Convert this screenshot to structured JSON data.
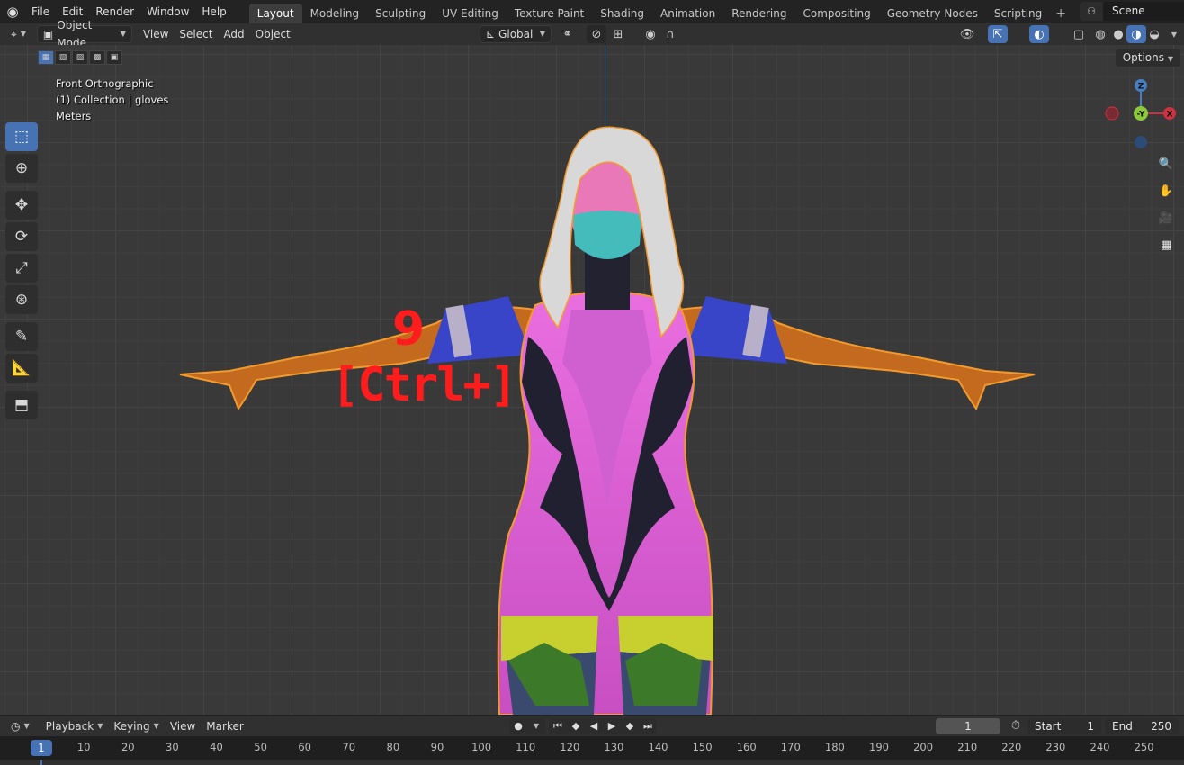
{
  "menu": {
    "items": [
      "File",
      "Edit",
      "Render",
      "Window",
      "Help"
    ]
  },
  "workspaces": {
    "tabs": [
      "Layout",
      "Modeling",
      "Sculpting",
      "UV Editing",
      "Texture Paint",
      "Shading",
      "Animation",
      "Rendering",
      "Compositing",
      "Geometry Nodes",
      "Scripting"
    ],
    "active": "Layout",
    "add": "+"
  },
  "scene": {
    "name": "Scene"
  },
  "viewport_header": {
    "mode": "Object Mode",
    "menus": [
      "View",
      "Select",
      "Add",
      "Object"
    ],
    "transform_orientation": "Global"
  },
  "viewport": {
    "view_name": "Front Orthographic",
    "collection": "(1) Collection | gloves",
    "units": "Meters",
    "options_label": "Options",
    "hint_number": "9",
    "hint_shortcut": "[Ctrl+]",
    "gizmo": {
      "z": "Z",
      "y": "-Y",
      "x": "X"
    }
  },
  "timeline": {
    "menus": [
      "Playback",
      "Keying",
      "View",
      "Marker"
    ],
    "current_frame": "1",
    "start_label": "Start",
    "start_value": "1",
    "end_label": "End",
    "end_value": "250",
    "ruler": [
      "1",
      "10",
      "20",
      "30",
      "40",
      "50",
      "60",
      "70",
      "80",
      "90",
      "100",
      "110",
      "120",
      "130",
      "140",
      "150",
      "160",
      "170",
      "180",
      "190",
      "200",
      "210",
      "220",
      "230",
      "240",
      "250"
    ]
  },
  "colors": {
    "accent": "#4772b3",
    "selection_outline": "#f39a2e",
    "hint_red": "#ff1c1c"
  }
}
